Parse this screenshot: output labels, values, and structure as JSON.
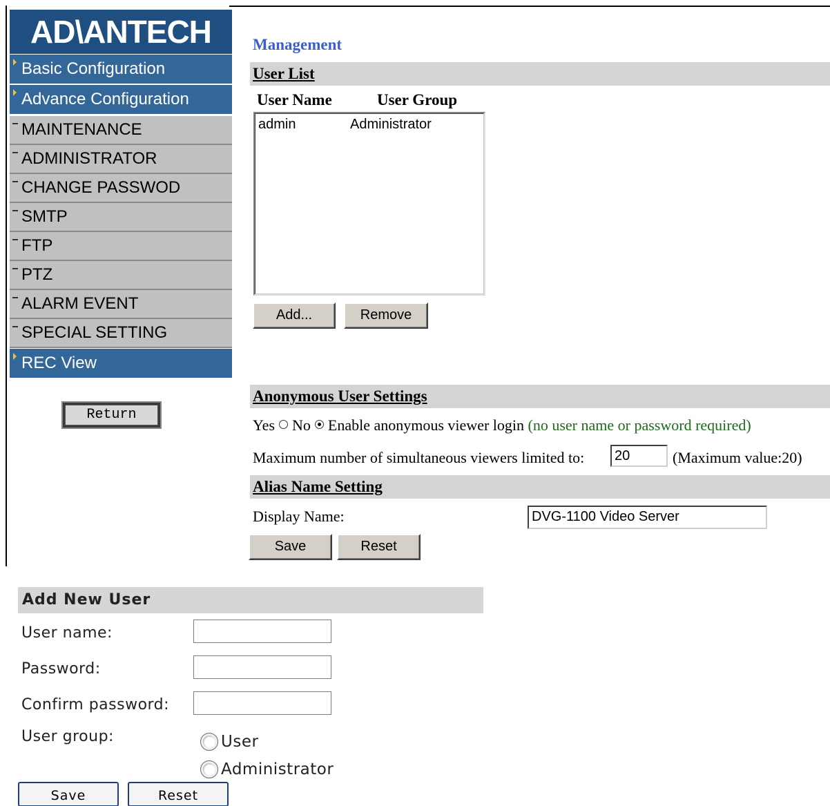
{
  "logo_text": "AD\\ANTECH",
  "nav": {
    "basic_config": "Basic Configuration",
    "advance_config": "Advance Configuration",
    "maintenance": "MAINTENANCE",
    "administrator": "ADMINISTRATOR",
    "change_password": "CHANGE PASSWOD",
    "smtp": "SMTP",
    "ftp": "FTP",
    "ptz": "PTZ",
    "alarm_event": "ALARM EVENT",
    "special_setting": "SPECIAL SETTING",
    "rec_view": "REC View"
  },
  "return_label": "Return",
  "management": {
    "title": "Management",
    "user_list_heading": "User List",
    "col_user_name": "User Name",
    "col_user_group": "User Group",
    "users": [
      {
        "name": "admin",
        "group": "Administrator"
      }
    ],
    "add_label": "Add...",
    "remove_label": "Remove"
  },
  "anonymous": {
    "heading": "Anonymous User Settings",
    "yes_label": "Yes",
    "no_label": "No",
    "selected": "No",
    "enable_text": "Enable anonymous viewer login",
    "note": "(no user name or password required)",
    "max_label": "Maximum number of simultaneous viewers limited to:",
    "max_value": "20",
    "max_note": "(Maximum value:20)"
  },
  "alias": {
    "heading": "Alias Name Setting",
    "display_label": "Display Name:",
    "display_value": "DVG-1100 Video Server",
    "save_label": "Save",
    "reset_label": "Reset"
  },
  "add_user": {
    "heading": "Add New User",
    "username_label": "User name:",
    "password_label": "Password:",
    "confirm_label": "Confirm password:",
    "group_label": "User group:",
    "group_user": "User",
    "group_admin": "Administrator",
    "save_label": "Save",
    "reset_label": "Reset"
  }
}
